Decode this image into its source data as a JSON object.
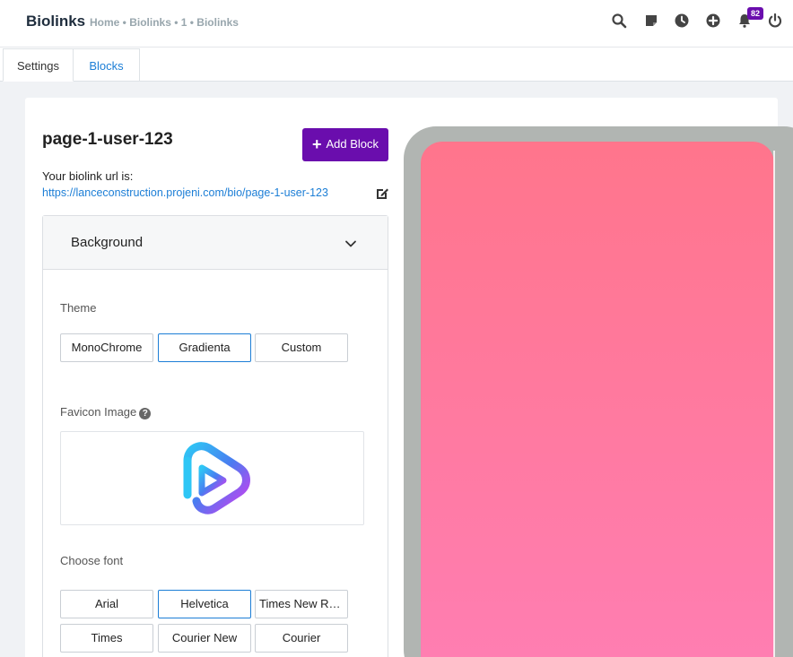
{
  "header": {
    "title": "Biolinks",
    "breadcrumb": "Home • Biolinks • 1 • Biolinks",
    "notification_count": "82",
    "icons": [
      "search-icon",
      "sticky-note-icon",
      "clock-icon",
      "plus-circle-icon",
      "bell-icon",
      "power-icon"
    ]
  },
  "tabs": [
    {
      "label": "Settings",
      "active": true
    },
    {
      "label": "Blocks",
      "active": false
    }
  ],
  "page": {
    "name": "page-1-user-123",
    "add_block_label": "Add Block",
    "url_label": "Your biolink url is:",
    "url": "https://lanceconstruction.projeni.com/bio/page-1-user-123"
  },
  "background_panel": {
    "title": "Background",
    "theme_label": "Theme",
    "themes": [
      "MonoChrome",
      "Gradienta",
      "Custom"
    ],
    "selected_theme": "Gradienta",
    "favicon_label": "Favicon Image",
    "font_label": "Choose font",
    "fonts": [
      "Arial",
      "Helvetica",
      "Times New Roman",
      "Times",
      "Courier New",
      "Courier"
    ],
    "selected_font": "Helvetica"
  },
  "preview": {
    "gradient_start": "#ff758c",
    "gradient_end": "#ff7eb3",
    "frame_color": "#b1b5b2"
  },
  "colors": {
    "accent": "#6a0dad",
    "link": "#1c7ed6"
  }
}
